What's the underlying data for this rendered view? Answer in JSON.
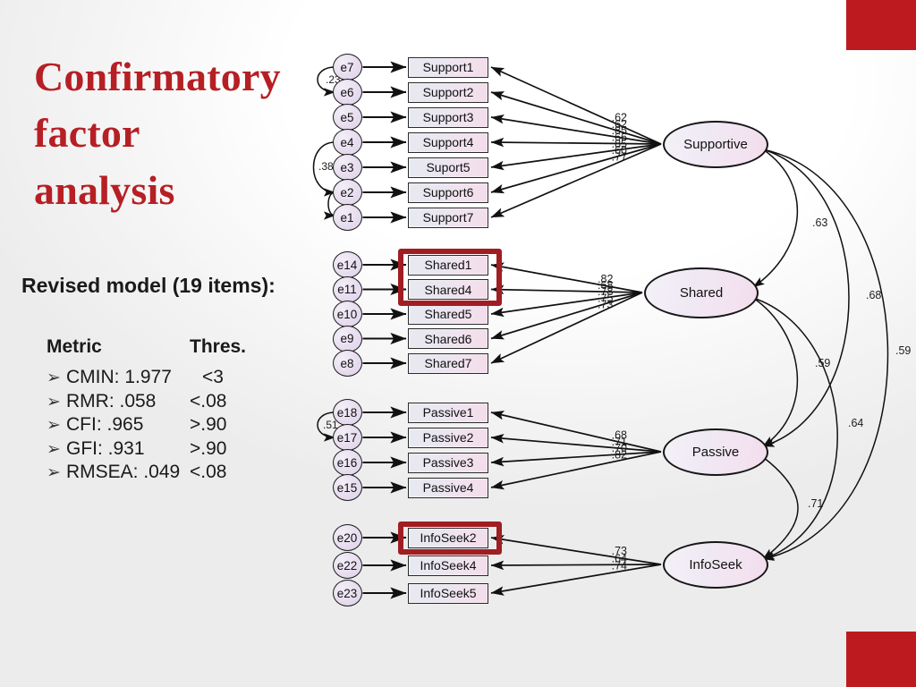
{
  "slide": {
    "title": "Confirmatory factor analysis",
    "title_lines": [
      "Confirmatory",
      "factor",
      "analysis"
    ],
    "revised_model_heading": "Revised model (19 items):",
    "accent_color": "#bd1a20",
    "title_color": "#b61f24"
  },
  "metrics_table": {
    "headers": [
      "Metric",
      "Thres."
    ],
    "bullet_glyph": "➢",
    "rows": [
      {
        "metric": "CMIN: 1.977",
        "threshold": "<3"
      },
      {
        "metric": "RMR: .058",
        "threshold": "<.08"
      },
      {
        "metric": "CFI: .965",
        "threshold": ">.90"
      },
      {
        "metric": "GFI: .931",
        "threshold": ">.90"
      },
      {
        "metric": "RMSEA: .049",
        "threshold": "<.08"
      }
    ]
  },
  "chart_data": {
    "type": "diagram",
    "diagram_kind": "confirmatory-factor-analysis-path-diagram",
    "title": "Confirmatory factor analysis",
    "n_items": 19,
    "factors": [
      {
        "id": "supportive",
        "label": "Supportive"
      },
      {
        "id": "shared",
        "label": "Shared"
      },
      {
        "id": "passive",
        "label": "Passive"
      },
      {
        "id": "infoseek",
        "label": "InfoSeek"
      }
    ],
    "blocks": [
      {
        "factor": "Supportive",
        "errors": [
          "e7",
          "e6",
          "e5",
          "e4",
          "e3",
          "e2",
          "e1"
        ],
        "indicators": [
          "Support1",
          "Support2",
          "Support3",
          "Support4",
          "Suport5",
          "Support6",
          "Support7"
        ],
        "loadings": [
          ".62",
          ".62",
          ".85",
          ".66",
          ".85",
          ".60",
          ".77"
        ],
        "highlight": null
      },
      {
        "factor": "Shared",
        "errors": [
          "e14",
          "e11",
          "e10",
          "e9",
          "e8"
        ],
        "indicators": [
          "Shared1",
          "Shared4",
          "Shared5",
          "Shared6",
          "Shared7"
        ],
        "loadings": [
          ".82",
          ".68",
          ".78",
          ".75",
          ".73"
        ],
        "highlight": [
          "Shared1",
          "Shared4"
        ]
      },
      {
        "factor": "Passive",
        "errors": [
          "e18",
          "e17",
          "e16",
          "e15"
        ],
        "indicators": [
          "Passive1",
          "Passive2",
          "Passive3",
          "Passive4"
        ],
        "loadings": [
          ".68",
          ".71",
          ".70",
          ".82"
        ],
        "highlight": null
      },
      {
        "factor": "InfoSeek",
        "errors": [
          "e20",
          "e22",
          "e23"
        ],
        "indicators": [
          "InfoSeek2",
          "InfoSeek4",
          "InfoSeek5"
        ],
        "loadings": [
          ".73",
          ".64",
          ".74"
        ],
        "highlight": [
          "InfoSeek2"
        ]
      }
    ],
    "error_covariances": [
      {
        "between": [
          "e7",
          "e6"
        ],
        "value": ".23"
      },
      {
        "between": [
          "e4",
          "e2"
        ],
        "value": ".38"
      },
      {
        "between": [
          "e2",
          "e1"
        ],
        "value": ""
      },
      {
        "between": [
          "e18",
          "e17"
        ],
        "value": ".51"
      }
    ],
    "factor_correlations": [
      {
        "between": [
          "Supportive",
          "Shared"
        ],
        "value": ".63"
      },
      {
        "between": [
          "Supportive",
          "Passive"
        ],
        "value": ".68"
      },
      {
        "between": [
          "Supportive",
          "InfoSeek"
        ],
        "value": ".59"
      },
      {
        "between": [
          "Shared",
          "Passive"
        ],
        "value": ".59"
      },
      {
        "between": [
          "Shared",
          "InfoSeek"
        ],
        "value": ".64"
      },
      {
        "between": [
          "Passive",
          "InfoSeek"
        ],
        "value": ".71"
      }
    ]
  }
}
